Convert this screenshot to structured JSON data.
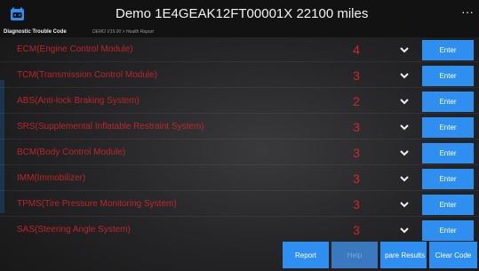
{
  "header": {
    "title": "Demo  1E4GEAK12FT00001X  22100 miles",
    "more_label": "···"
  },
  "subheader": {
    "title": "Diagnostic Trouble Code",
    "path": "DEMO V15.00 > Health Report"
  },
  "systems": [
    {
      "name": "ECM(Engine Control Module)",
      "count": "4",
      "enter_label": "Enter"
    },
    {
      "name": "TCM(Transmission Control Module)",
      "count": "3",
      "enter_label": "Enter"
    },
    {
      "name": "ABS(Anti-lock Braking System)",
      "count": "2",
      "enter_label": "Enter"
    },
    {
      "name": "SRS(Supplemental Inflatable Restraint System)",
      "count": "3",
      "enter_label": "Enter"
    },
    {
      "name": "BCM(Body Control Module)",
      "count": "3",
      "enter_label": "Enter"
    },
    {
      "name": "IMM(Immobilizer)",
      "count": "3",
      "enter_label": "Enter"
    },
    {
      "name": "TPMS(Tire Pressure Monitoring System)",
      "count": "3",
      "enter_label": "Enter"
    },
    {
      "name": "SAS(Steering Angle System)",
      "count": "3",
      "enter_label": "Enter"
    }
  ],
  "toolbar": {
    "report": "Report",
    "help": "Help",
    "compare": "pare Results",
    "clear": "Clear Code"
  },
  "colors": {
    "accent": "#2f8ff0",
    "fault_text": "#d6262a",
    "titlebar": "#121213"
  }
}
